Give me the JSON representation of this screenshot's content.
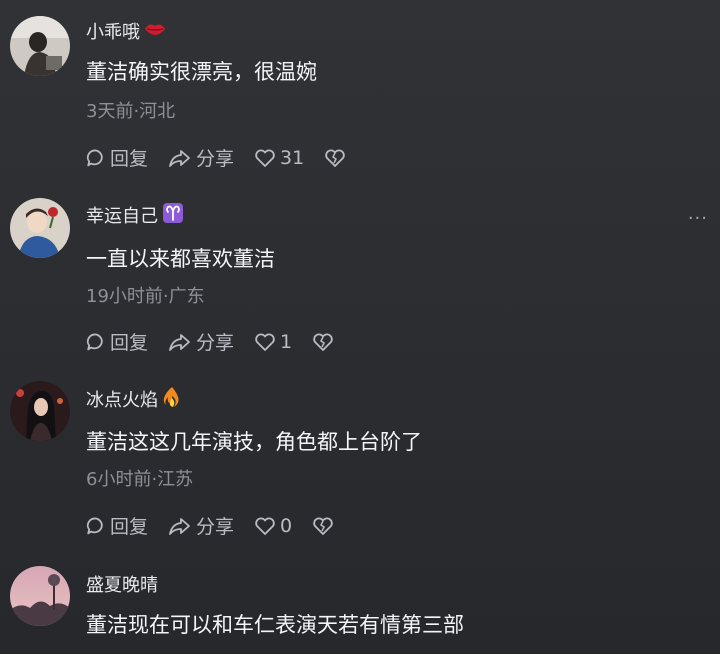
{
  "comments": [
    {
      "user": "小乖哦",
      "badge_icon": "lips-icon",
      "text": "董洁确实很漂亮，很温婉",
      "meta": "3天前·河北",
      "reply_label": "回复",
      "share_label": "分享",
      "likes": "31"
    },
    {
      "user": "幸运自己",
      "badge_icon": "aries-icon",
      "text": "一直以来都喜欢董洁",
      "meta": "19小时前·广东",
      "reply_label": "回复",
      "share_label": "分享",
      "likes": "1"
    },
    {
      "user": "冰点火焰",
      "badge_icon": "fire-icon",
      "text": "董洁这这几年演技，角色都上台阶了",
      "meta": "6小时前·江苏",
      "reply_label": "回复",
      "share_label": "分享",
      "likes": "0"
    },
    {
      "user": "盛夏晚晴",
      "text": "董洁现在可以和车仁表演天若有情第三部"
    }
  ],
  "more_menu": "···",
  "colors": {
    "background": "#2b2d31",
    "username": "#e8e9ec",
    "meta": "#8d9096",
    "action": "#b9bcc2"
  }
}
